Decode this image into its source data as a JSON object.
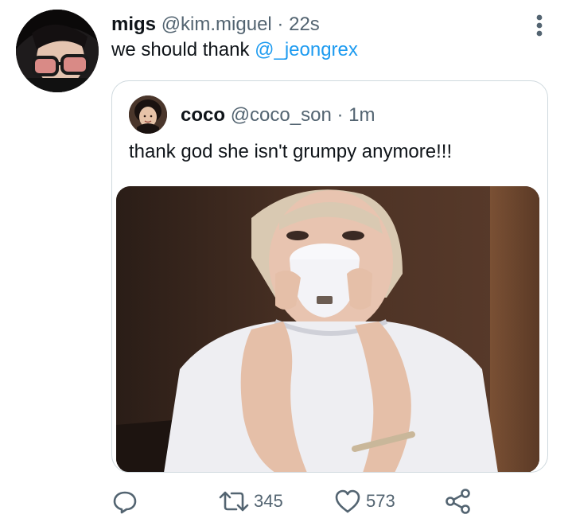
{
  "tweet": {
    "author_name": "migs",
    "author_handle": "@kim.miguel",
    "separator": "·",
    "time": "22s",
    "text_prefix": "we should thank ",
    "mention": "@_jeongrex"
  },
  "quoted": {
    "author_name": "coco",
    "author_handle": "@coco_son",
    "separator": "·",
    "time": "1m",
    "text": "thank god she isn't grumpy anymore!!!"
  },
  "actions": {
    "retweet_count": "345",
    "like_count": "573"
  },
  "colors": {
    "text": "#0f1419",
    "secondary": "#536471",
    "link": "#1d9bf0",
    "border": "#cfd9de"
  },
  "icons": [
    "more-icon",
    "reply-icon",
    "retweet-icon",
    "like-icon",
    "share-icon"
  ]
}
